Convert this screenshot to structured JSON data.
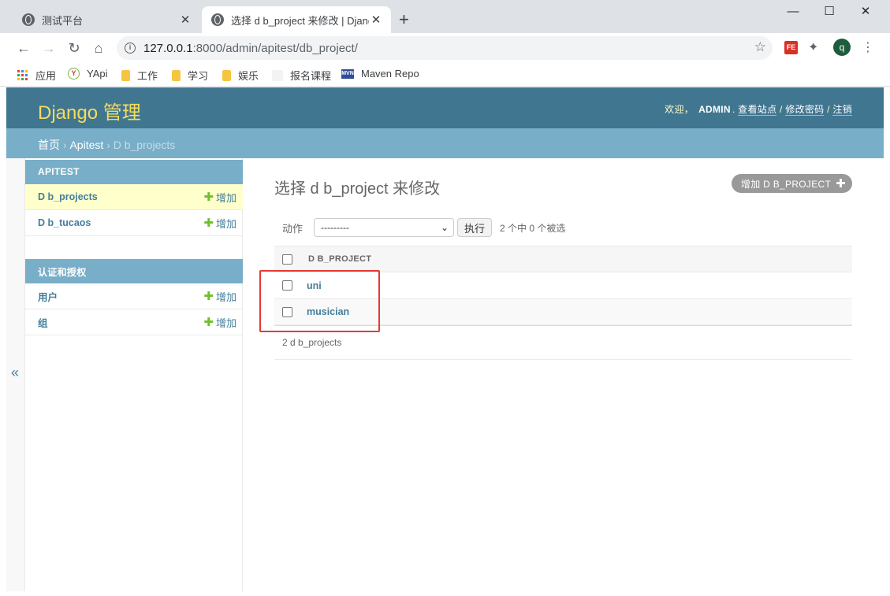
{
  "browser": {
    "tabs": [
      {
        "title": "测试平台",
        "close": "✕"
      },
      {
        "title": "选择 d b_project 来修改 | Django 站点管理",
        "close": "✕"
      }
    ],
    "new_tab": "+",
    "window_controls": {
      "minimize": "—",
      "maximize": "☐",
      "close": "✕"
    },
    "nav": {
      "back": "←",
      "forward": "→",
      "reload": "↻",
      "home": "⌂"
    },
    "url": {
      "host": "127.0.0.1",
      "rest": ":8000/admin/apitest/db_project/"
    },
    "star": "☆",
    "fe_badge": "FE",
    "extensions": "✦",
    "profile_initial": "q",
    "menu": "⋮",
    "bookmarks": [
      "应用",
      "YApi",
      "工作",
      "学习",
      "娱乐",
      "报名课程",
      "Maven Repo"
    ],
    "yapi_glyph": "Y",
    "mvn_glyph": "MVN"
  },
  "admin": {
    "branding": "Django 管理",
    "user_tools": {
      "welcome": "欢迎，",
      "username": "ADMIN",
      "dot": ".",
      "view_site": "查看站点",
      "sep1": " / ",
      "change_password": "修改密码",
      "sep2": " / ",
      "logout": "注销"
    },
    "breadcrumbs": {
      "home": "首页",
      "sep1": " › ",
      "app": "Apitest",
      "sep2": " › ",
      "current": "D b_projects"
    },
    "sidebar": {
      "toggle": "«",
      "modules": [
        {
          "caption": "APITEST",
          "rows": [
            {
              "label": "D b_projects",
              "add": "增加"
            },
            {
              "label": "D b_tucaos",
              "add": "增加"
            }
          ]
        },
        {
          "caption": "认证和授权",
          "rows": [
            {
              "label": "用户",
              "add": "增加"
            },
            {
              "label": "组",
              "add": "增加"
            }
          ]
        }
      ],
      "plus": "✚"
    },
    "content": {
      "title": "选择 d b_project 来修改",
      "add_button": "增加 D B_PROJECT",
      "add_plus": "✚",
      "actions": {
        "label": "动作",
        "selected": "---------",
        "arrow": "⌄",
        "go": "执行",
        "counter": "2 个中 0 个被选"
      },
      "table": {
        "header": "D B_PROJECT",
        "rows": [
          "uni",
          "musician"
        ]
      },
      "paginator": "2 d b_projects"
    }
  },
  "colors": {
    "header": "#417690",
    "breadcrumbs": "#79aec8",
    "branding": "#f5dd5d",
    "link": "#447e9b",
    "add_plus": "#70bf2b",
    "highlight": "#e53935"
  }
}
